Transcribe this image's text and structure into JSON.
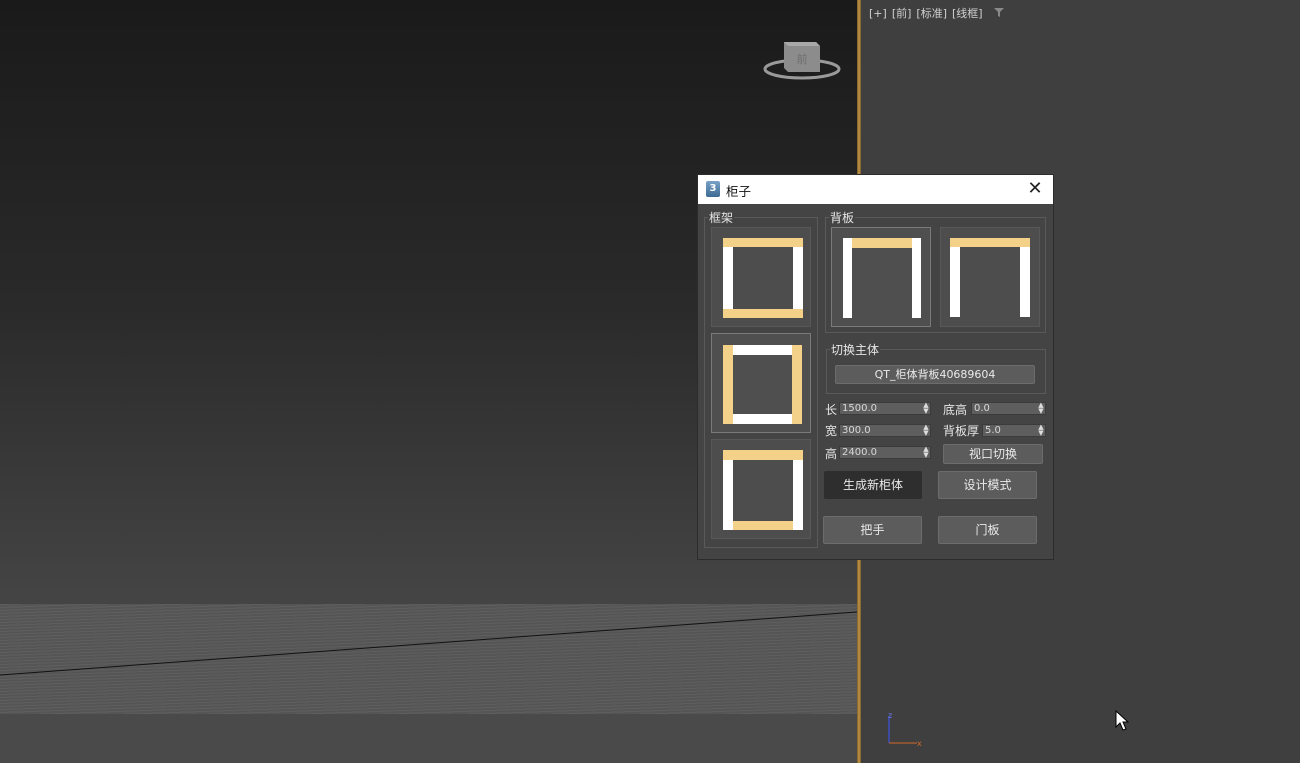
{
  "viewport_left": {
    "viewcube_label": "前"
  },
  "viewport_right": {
    "labels": [
      "[+]",
      "[前]",
      "[标准]",
      "[线框]"
    ],
    "filter_icon": "funnel-icon",
    "axis": {
      "z": "z",
      "x": "x"
    }
  },
  "dialog": {
    "title": "柜子",
    "close_icon": "close-icon",
    "frame_group_label": "框架",
    "back_group_label": "背板",
    "switch_group_label": "切换主体",
    "switch_value": "QT_柜体背板40689604",
    "fields": {
      "length": {
        "label": "长",
        "value": "1500.0"
      },
      "width": {
        "label": "宽",
        "value": "300.0"
      },
      "height": {
        "label": "高",
        "value": "2400.0"
      },
      "base_height": {
        "label": "底高",
        "value": "0.0"
      },
      "back_thickness": {
        "label": "背板厚",
        "value": "5.0"
      }
    },
    "buttons": {
      "view_switch": "视口切换",
      "new_cabinet": "生成新柜体",
      "design_mode": "设计模式",
      "handle": "把手",
      "door_panel": "门板"
    }
  },
  "colors": {
    "accent_yellow": "#f4d189",
    "panel_white": "#ffffff",
    "dialog_bg": "#444444"
  }
}
